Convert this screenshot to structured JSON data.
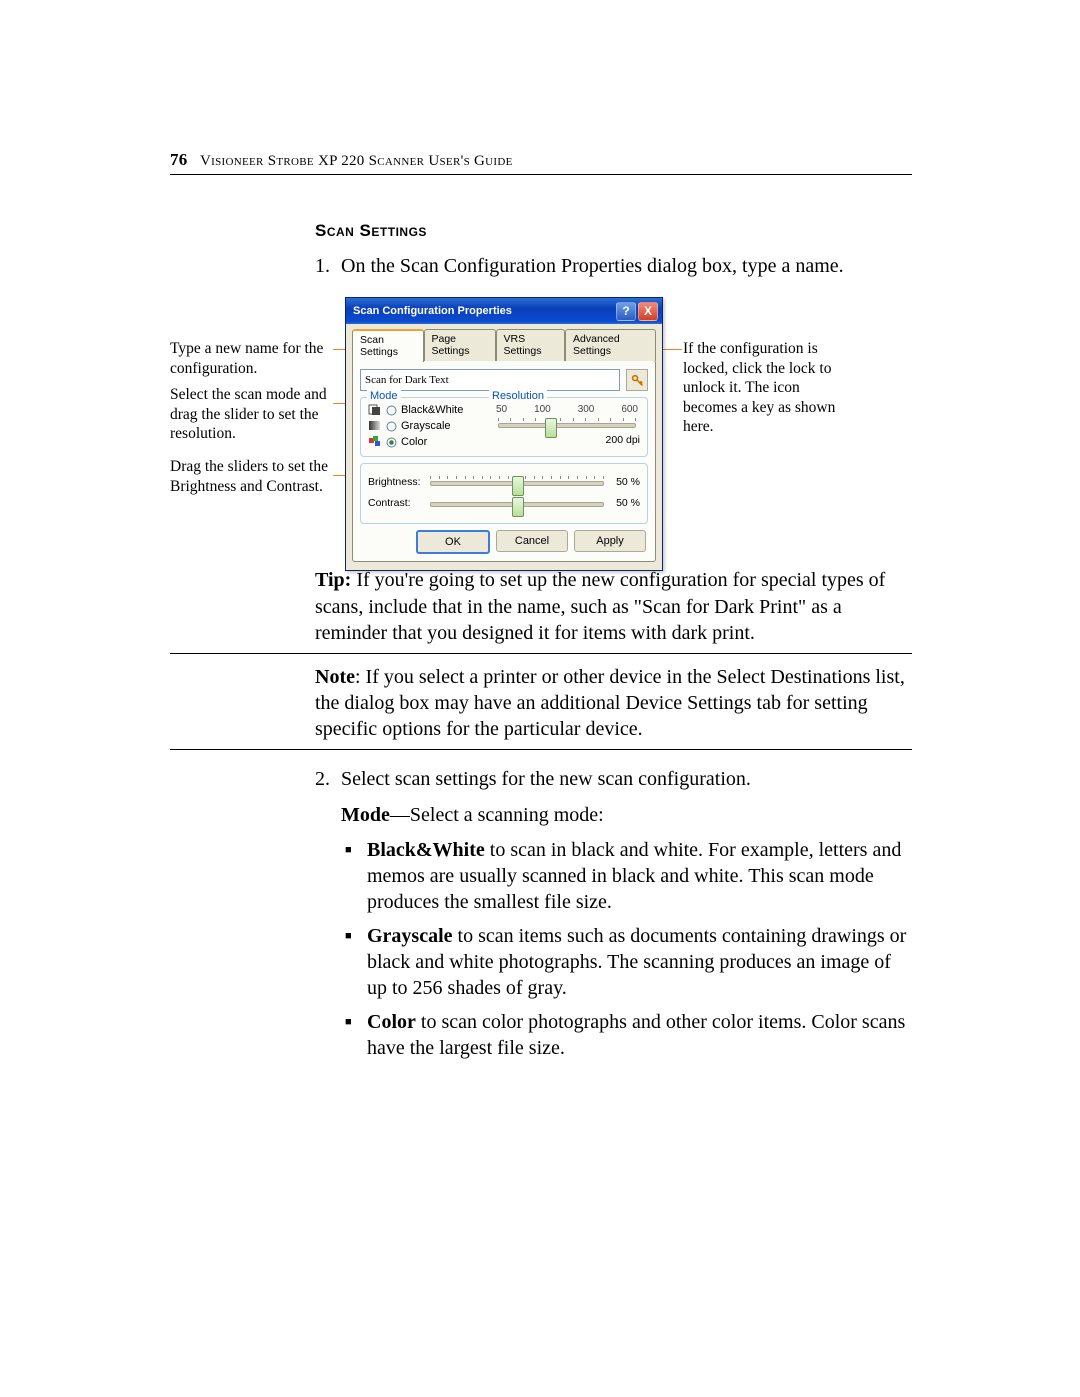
{
  "header": {
    "page_number": "76",
    "title": "Visioneer Strobe XP 220 Scanner User's Guide"
  },
  "section_title": "Scan Settings",
  "step1_num": "1.",
  "step1_text": "On the Scan Configuration Properties dialog box, type a name.",
  "callouts": {
    "left1": "Type a new name for the configuration.",
    "left2": "Select the scan mode and drag the slider to set the resolution.",
    "left3": "Drag the sliders to set the Brightness and Contrast.",
    "right1": "If the configuration is locked, click the lock to unlock it. The icon becomes a key as shown here."
  },
  "dialog": {
    "title": "Scan Configuration Properties",
    "help": "?",
    "close": "X",
    "tabs": [
      "Scan Settings",
      "Page Settings",
      "VRS Settings",
      "Advanced Settings"
    ],
    "name_value": "Scan for Dark Text",
    "mode_legend": "Mode",
    "res_legend": "Resolution",
    "modes": {
      "bw": "Black&White",
      "gs": "Grayscale",
      "color": "Color"
    },
    "res_ticks": [
      "50",
      "100",
      "300",
      "600"
    ],
    "res_value": "200 dpi",
    "brightness_label": "Brightness:",
    "contrast_label": "Contrast:",
    "brightness_value": "50 %",
    "contrast_value": "50 %",
    "buttons": {
      "ok": "OK",
      "cancel": "Cancel",
      "apply": "Apply"
    }
  },
  "tip_label": "Tip:",
  "tip_text": " If you're going to set up the new configuration for special types of scans, include that in the name, such as \"Scan for Dark Print\" as a reminder that you designed it for items with dark print.",
  "note_label": "Note",
  "note_text": ":  If you select a printer or other device in the Select Destinations list, the dialog box may have an additional Device Settings tab for setting specific options for the particular device.",
  "step2_num": "2.",
  "step2_text": "Select scan settings for the new scan configuration.",
  "mode_label": "Mode",
  "mode_intro_text": "—Select a scanning mode:",
  "bullets": {
    "bw_label": "Black&White",
    "bw_text": " to scan in black and white. For example, letters and memos are usually scanned in black and white. This scan mode produces the smallest file size.",
    "gs_label": "Grayscale",
    "gs_text": " to scan items such as documents containing drawings or black and white photographs. The scanning produces an image of up to 256 shades of gray.",
    "c_label": "Color",
    "c_text": " to scan color photographs and other color items. Color scans have the largest file size."
  }
}
